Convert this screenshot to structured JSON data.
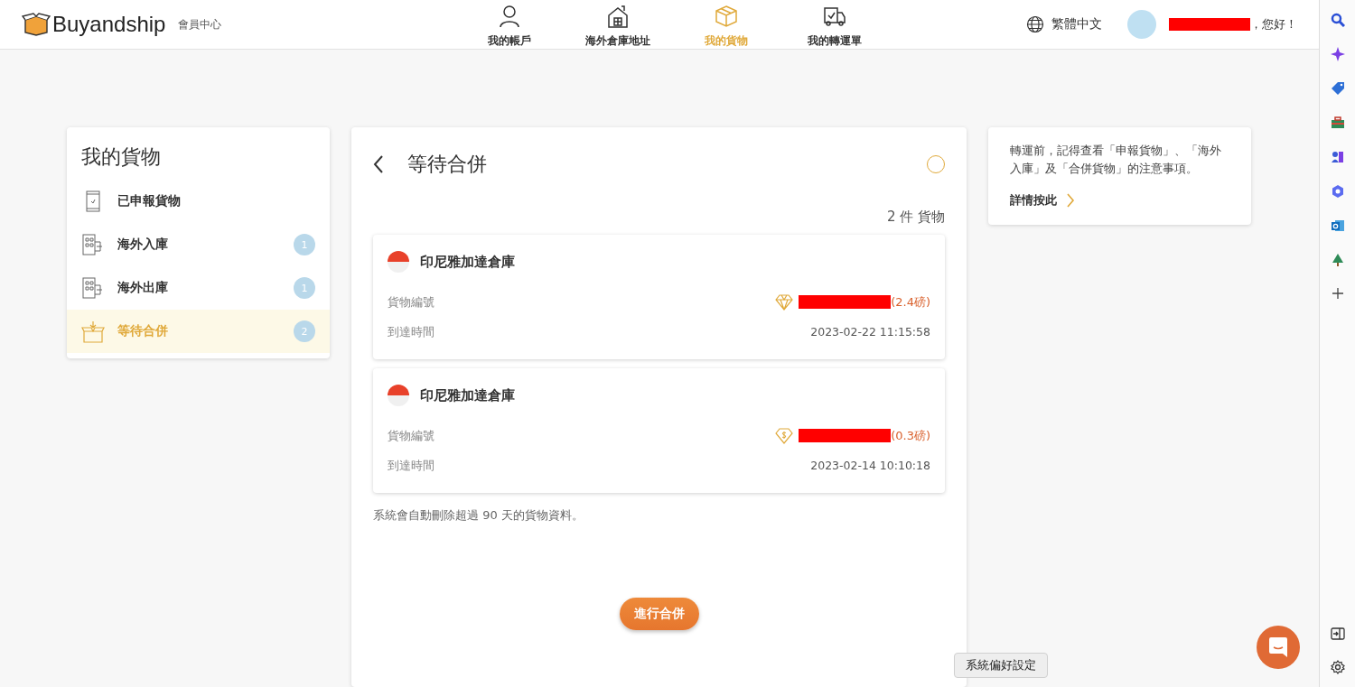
{
  "header": {
    "logo_text": "Buyandship",
    "subtitle": "會員中心",
    "nav": [
      {
        "label": "我的帳戶",
        "kind": "person",
        "selected": false
      },
      {
        "label": "海外倉庫地址",
        "kind": "house",
        "selected": false
      },
      {
        "label": "我的貨物",
        "kind": "box",
        "selected": true
      },
      {
        "label": "我的轉運單",
        "kind": "truck",
        "selected": false
      }
    ],
    "language": "繁體中文",
    "greeting": "，您好！"
  },
  "sidebar": {
    "title": "我的貨物",
    "items": [
      {
        "label": "已申報貨物",
        "kind": "phone",
        "selected": false
      },
      {
        "label": "海外入庫",
        "kind": "building",
        "count": "1",
        "selected": false
      },
      {
        "label": "海外出庫",
        "kind": "building",
        "count": "1",
        "selected": false
      },
      {
        "label": "等待合併",
        "kind": "box",
        "count": "2",
        "selected": true
      }
    ]
  },
  "main": {
    "title": "等待合併",
    "count_text": "2 件 貨物",
    "shipments": [
      {
        "warehouse": "印尼雅加達倉庫",
        "id_label": "貨物編號",
        "kind": "diamond",
        "weight": "(2.4磅)",
        "arrival_label": "到達時間",
        "arrival_time": "2023-02-22 11:15:58"
      },
      {
        "warehouse": "印尼雅加達倉庫",
        "id_label": "貨物編號",
        "kind": "dollar",
        "weight": "(0.3磅)",
        "arrival_label": "到達時間",
        "arrival_time": "2023-02-14 10:10:18"
      }
    ],
    "note": "系統會自動刪除超過 90 天的貨物資料。",
    "merge_button": "進行合併"
  },
  "tip": {
    "text": "轉運前，記得查看「申報貨物」、「海外入庫」及「合併貨物」的注意事項。",
    "link": "詳情按此"
  },
  "tooltip": "系統偏好設定"
}
